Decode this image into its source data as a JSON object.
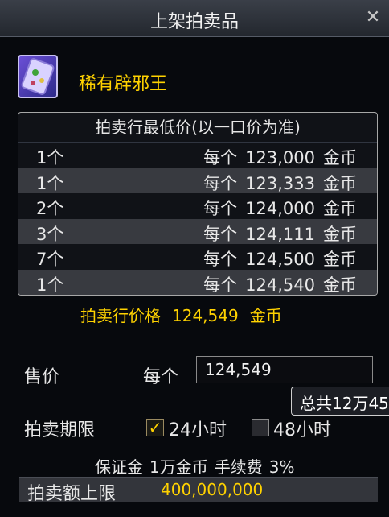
{
  "window": {
    "title": "上架拍卖品"
  },
  "item": {
    "name": "稀有辟邪王",
    "icon": "amulet-icon"
  },
  "market": {
    "header": "拍卖行最低价(以一口价为准)",
    "rows": [
      {
        "qty": "1个",
        "each": "每个",
        "price": "123,000",
        "currency": "金币"
      },
      {
        "qty": "1个",
        "each": "每个",
        "price": "123,333",
        "currency": "金币"
      },
      {
        "qty": "2个",
        "each": "每个",
        "price": "124,000",
        "currency": "金币"
      },
      {
        "qty": "3个",
        "each": "每个",
        "price": "124,111",
        "currency": "金币"
      },
      {
        "qty": "7个",
        "each": "每个",
        "price": "124,500",
        "currency": "金币"
      },
      {
        "qty": "1个",
        "each": "每个",
        "price": "124,540",
        "currency": "金币"
      }
    ],
    "market_price_label": "拍卖行价格",
    "market_price_value": "124,549",
    "market_price_currency": "金币"
  },
  "sell": {
    "label": "售价",
    "each_label": "每个",
    "price_value": "124,549",
    "total_tooltip": "总共12万45"
  },
  "duration": {
    "label": "拍卖期限",
    "option_24": "24小时",
    "option_24_checked": true,
    "option_48": "48小时",
    "option_48_checked": false
  },
  "fee": {
    "label": "保证金",
    "amount": "1万金币",
    "fee_label": "手续费",
    "fee_rate": "3%"
  },
  "limit": {
    "label": "拍卖额上限",
    "value": "400,000,000"
  },
  "colors": {
    "gold": "#ffd200",
    "panel": "#07090d"
  }
}
